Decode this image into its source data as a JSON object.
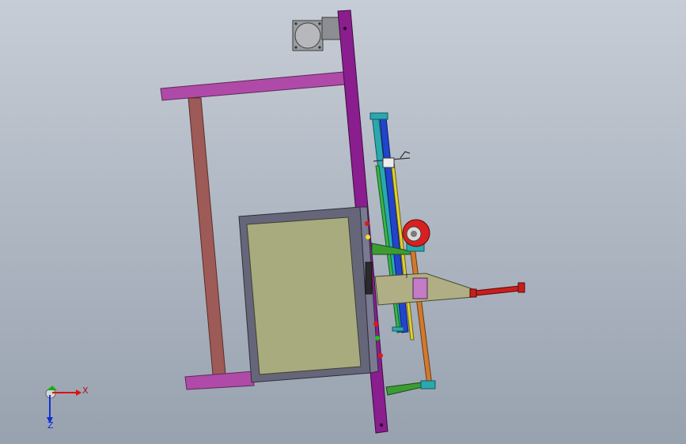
{
  "triad": {
    "x_label": "X",
    "z_label": "Z",
    "x_color": "#e01010",
    "y_color": "#10b010",
    "z_color": "#1030d0"
  },
  "colors": {
    "frame_magenta": "#b04aa8",
    "post_red": "#9e5a56",
    "column_purple": "#8a1e8e",
    "panel_border": "#66667a",
    "panel_screen": "#a8ab7e",
    "bracket_green": "#3c9c34",
    "arm_tan": "#b0ae84",
    "rod_red": "#c81e1e",
    "wheel_red": "#d82020",
    "shaft_orange": "#d07a30",
    "rail_teal": "#2aa8b0",
    "rail_blue": "#2244cc",
    "rail_yellow": "#e0d030",
    "motor_gray": "#9a9ca0"
  }
}
